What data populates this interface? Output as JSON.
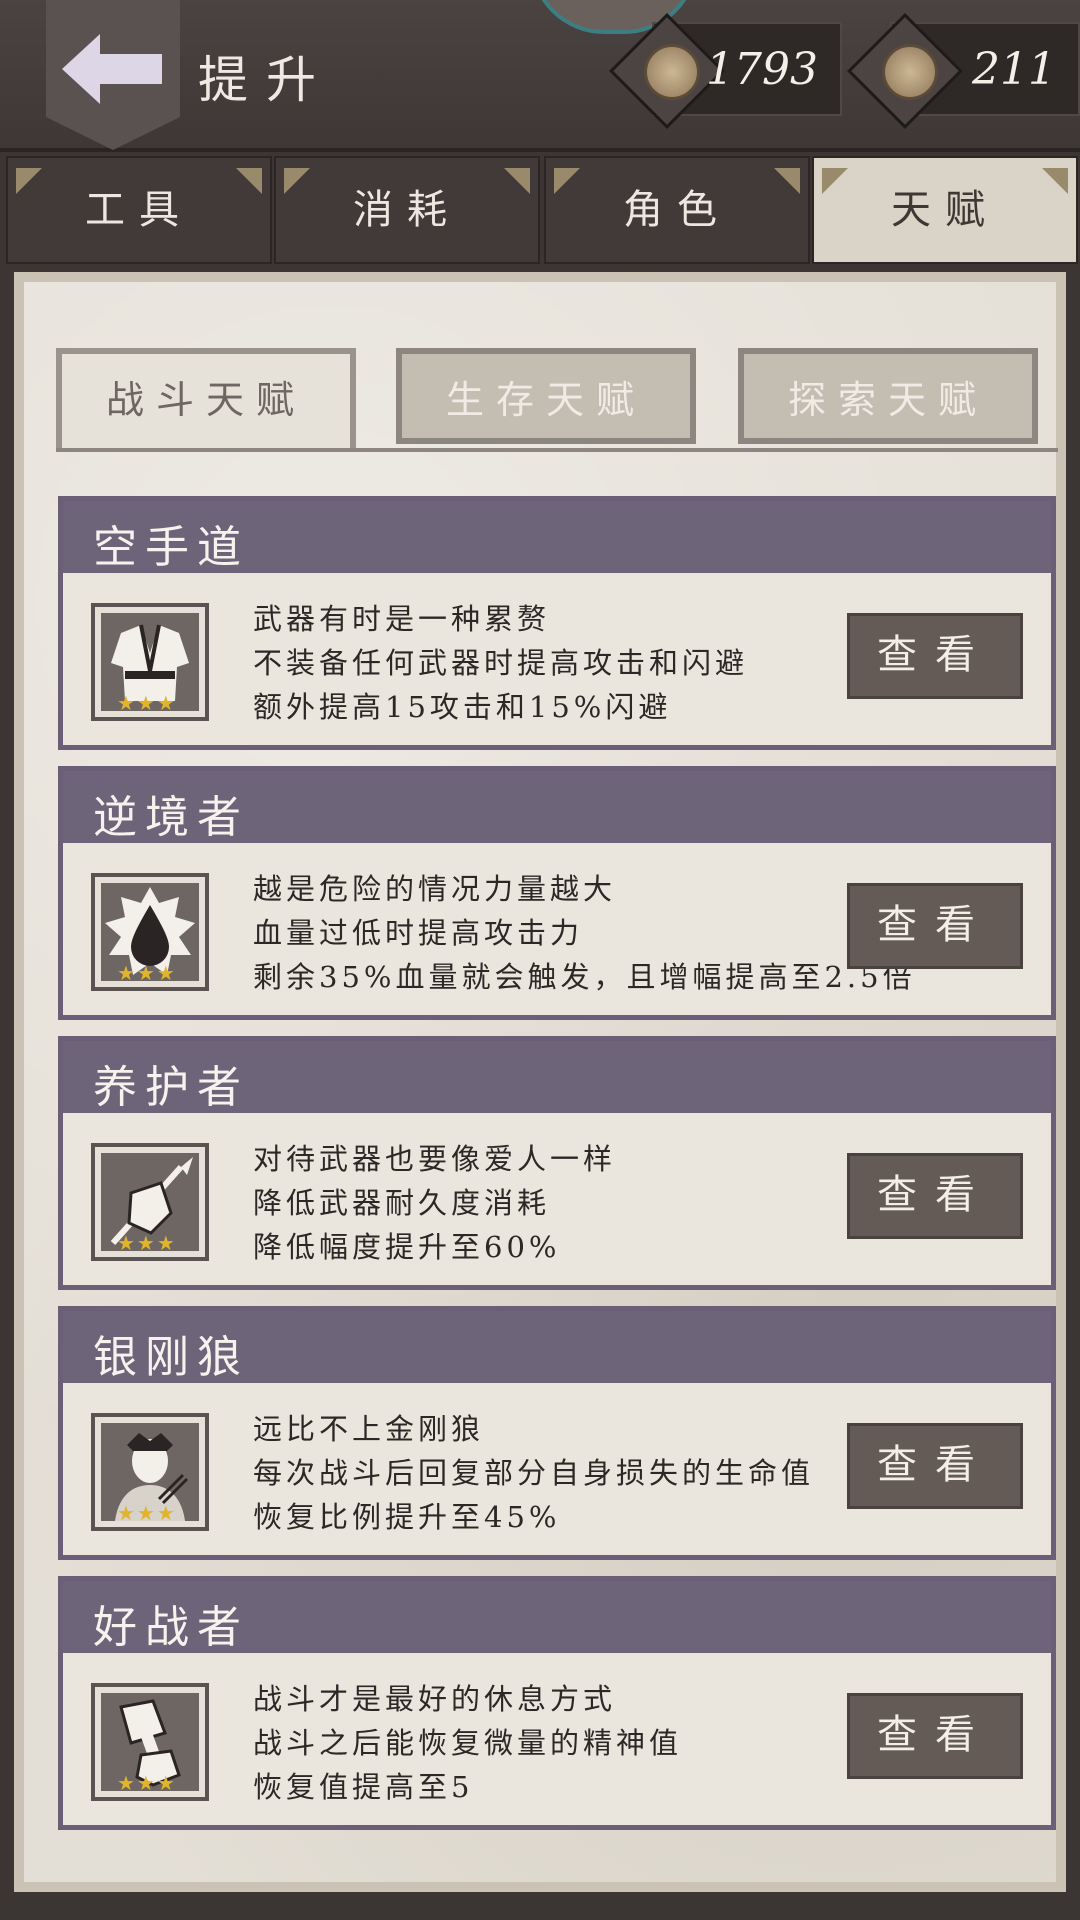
{
  "header": {
    "title": "提升",
    "currency1": {
      "value": "1793",
      "icon": "coin-icon"
    },
    "currency2": {
      "value": "211",
      "icon": "coin-icon"
    }
  },
  "tabs": [
    {
      "label": "工具",
      "active": false
    },
    {
      "label": "消耗",
      "active": false
    },
    {
      "label": "角色",
      "active": false
    },
    {
      "label": "天赋",
      "active": true
    }
  ],
  "subtabs": [
    {
      "label": "战斗天赋",
      "active": true
    },
    {
      "label": "生存天赋",
      "active": false
    },
    {
      "label": "探索天赋",
      "active": false
    }
  ],
  "talents": [
    {
      "name": "空手道",
      "icon": "karate-gi-icon",
      "stars": "★★★",
      "lines": [
        "武器有时是一种累赘",
        "不装备任何武器时提高攻击和闪避",
        "额外提高15攻击和15%闪避"
      ],
      "button": "查看"
    },
    {
      "name": "逆境者",
      "icon": "blood-drop-icon",
      "stars": "★★★",
      "lines": [
        "越是危险的情况力量越大",
        "血量过低时提高攻击力",
        "剩余35%血量就会触发，且增幅提高至2.5倍"
      ],
      "button": "查看"
    },
    {
      "name": "养护者",
      "icon": "spear-hand-icon",
      "stars": "★★★",
      "lines": [
        "对待武器也要像爱人一样",
        "降低武器耐久度消耗",
        "降低幅度提升至60%"
      ],
      "button": "查看"
    },
    {
      "name": "银刚狼",
      "icon": "wolverine-portrait-icon",
      "stars": "★★★",
      "lines": [
        "远比不上金刚狼",
        "每次战斗后回复部分自身损失的生命值",
        "恢复比例提升至45%"
      ],
      "button": "查看"
    },
    {
      "name": "好战者",
      "icon": "cleaver-hand-icon",
      "stars": "★★★",
      "lines": [
        "战斗才是最好的休息方式",
        "战斗之后能恢复微量的精神值",
        "恢复值提高至5"
      ],
      "button": "查看"
    }
  ]
}
